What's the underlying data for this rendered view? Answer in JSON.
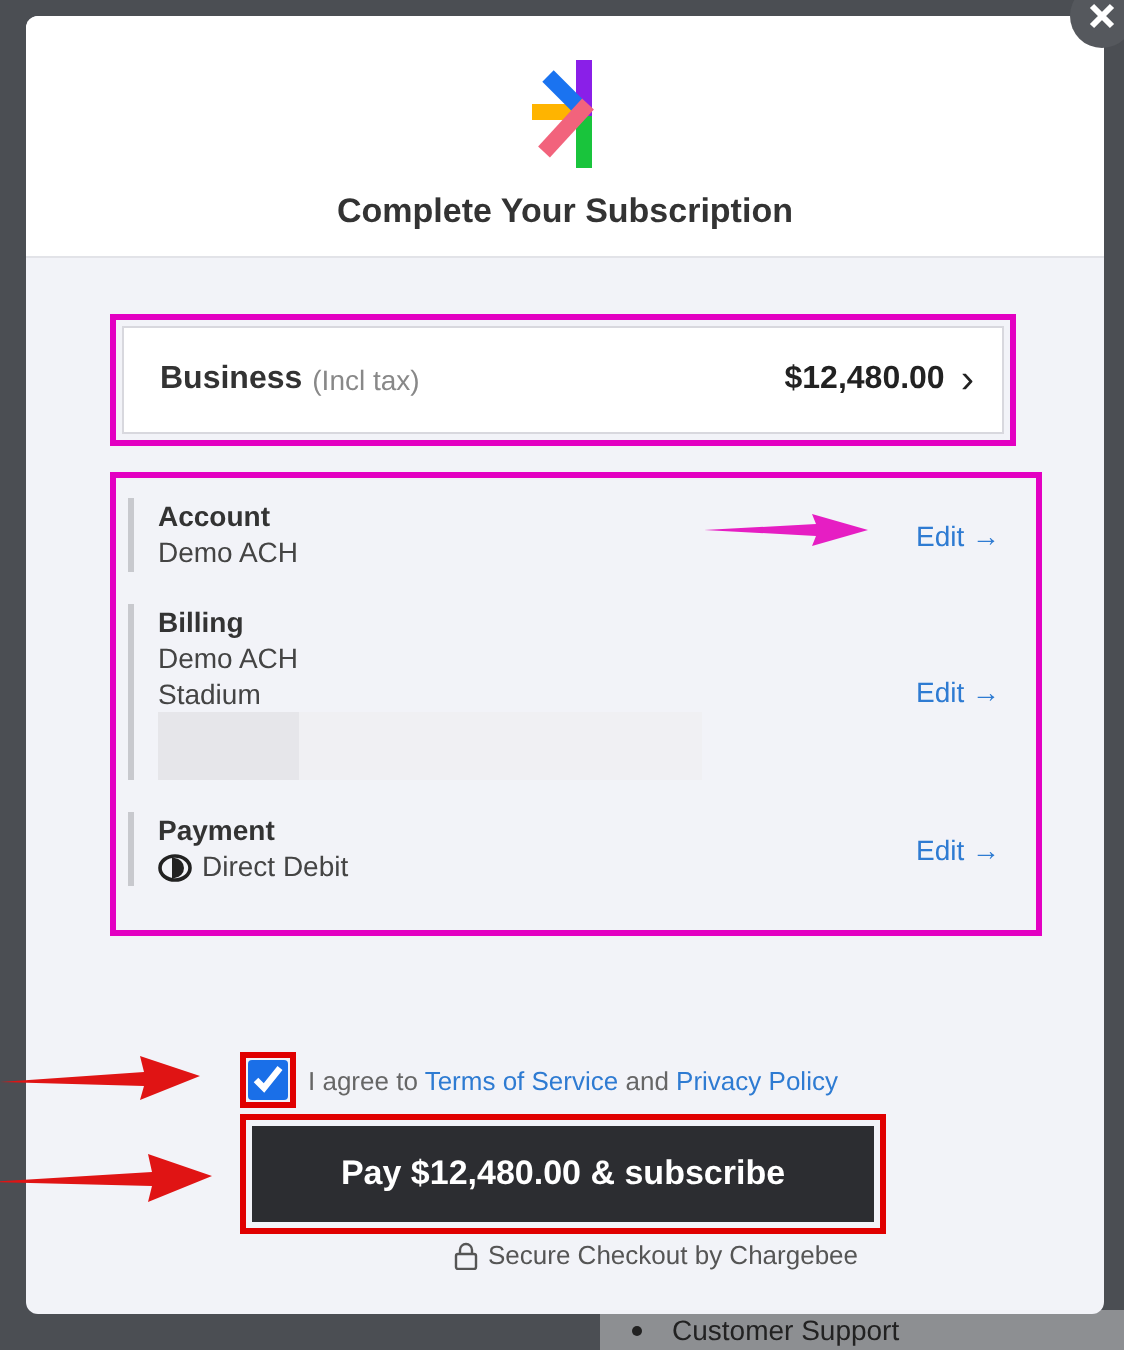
{
  "modal": {
    "title": "Complete Your Subscription"
  },
  "plan": {
    "name": "Business",
    "note": "(Incl tax)",
    "price": "$12,480.00",
    "chevron": "›"
  },
  "sections": [
    {
      "kind": "text",
      "heading": "Account",
      "lines": [
        "Demo ACH"
      ],
      "action": "Edit →"
    },
    {
      "kind": "redacted",
      "heading": "Billing",
      "lines": [
        "Demo ACH",
        "Stadium"
      ],
      "action": "Edit →"
    },
    {
      "kind": "payment",
      "heading": "Payment",
      "lines": [
        "Direct Debit"
      ],
      "action": "Edit →"
    }
  ],
  "consent": {
    "checked": true,
    "prefix": "I agree to",
    "terms": "Terms of Service",
    "joiner": "and",
    "privacy": "Privacy Policy"
  },
  "pay_button": "Pay $12,480.00 & subscribe",
  "footer": "Secure Checkout by Chargebee",
  "background": {
    "list_item": "Customer Support"
  }
}
